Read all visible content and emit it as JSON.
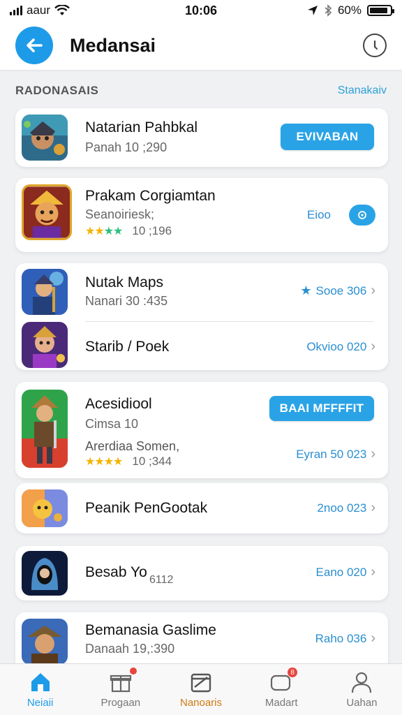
{
  "status_bar": {
    "carrier": "aaur",
    "time": "10:06",
    "battery": "60%"
  },
  "header": {
    "title": "Medansai"
  },
  "section": {
    "title": "RADONASAIS",
    "link": "Stanakaiv"
  },
  "cards": [
    {
      "title": "Natarian Pahbkal",
      "sub": "Panah    10 ;290",
      "button": "EVIVABAN"
    },
    {
      "title": "Prakam Corgiamtan",
      "sub": "Seanoiriesk;",
      "rating_value": "10 ;196",
      "link": "Eioo",
      "tag": "©"
    },
    {
      "rows": [
        {
          "title": "Nutak Maps",
          "sub": "Nanari    30 :435",
          "link": "Sooe 306"
        },
        {
          "title": "Starib / Poek",
          "link": "Okvioo 020"
        }
      ]
    },
    {
      "title": "Acesidiool",
      "sub": "Cimsa    10",
      "sub2": "Arerdiaa Somen,",
      "rating_value": "10 ;344",
      "button": "BAAI MFFFFIT",
      "link": "Eyran 50 023"
    },
    {
      "title": "Peanik PenGootak",
      "link": "2noo 023"
    },
    {
      "title": "Besab Yo",
      "sub": "6112",
      "link": "Eano 020"
    },
    {
      "title": "Bemanasia Gaslime",
      "sub": "Danaah    19,:390",
      "link": "Raho 036"
    }
  ],
  "bottom_nav": [
    {
      "label": "Neiaii",
      "icon": "home-icon"
    },
    {
      "label": "Progaan",
      "icon": "gift-icon",
      "badge": ""
    },
    {
      "label": "Nanoaris",
      "icon": "box-icon"
    },
    {
      "label": "Madart",
      "icon": "chat-icon",
      "badge": "8"
    },
    {
      "label": "Uahan",
      "icon": "user-icon"
    }
  ],
  "colors": {
    "accent": "#1e9be8",
    "button": "#2aa3e6",
    "link": "#2a8fd0",
    "star": "#f4b400",
    "badge": "#e8453c"
  }
}
